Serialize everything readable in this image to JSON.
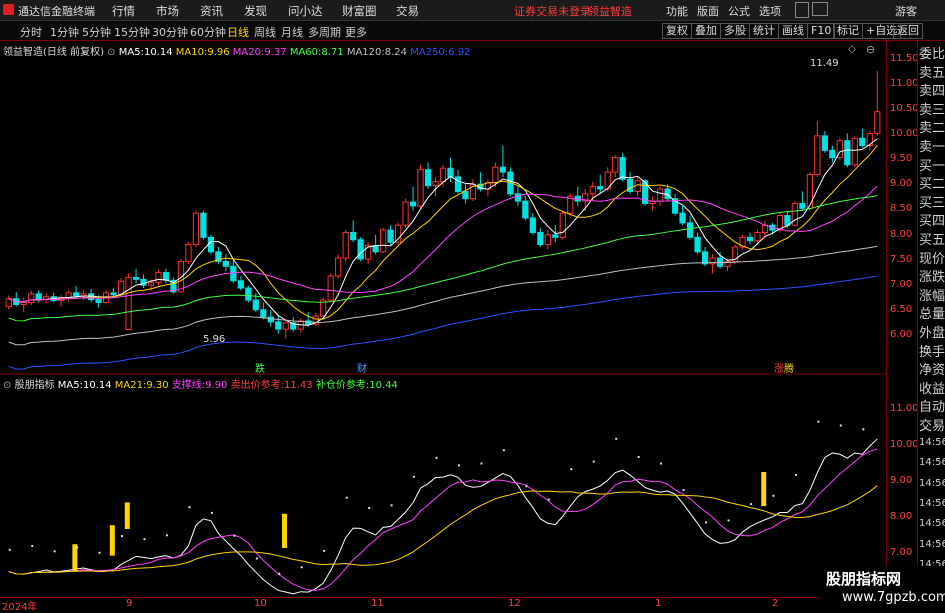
{
  "titlebar": {
    "app_title": "通达信金融终端",
    "menus": [
      "行情",
      "市场",
      "资讯",
      "发现",
      "问小达",
      "财富圈",
      "交易"
    ],
    "alert_login": "证券交易未登录",
    "alert_stock": "领益智造",
    "right_menus": [
      "功能",
      "版面",
      "公式",
      "选项"
    ],
    "user": "游客"
  },
  "toolbar": {
    "periods": [
      "分时",
      "1分钟",
      "5分钟",
      "15分钟",
      "30分钟",
      "60分钟",
      "日线",
      "周线",
      "月线",
      "多周期",
      "更多"
    ],
    "active_period": "日线",
    "buttons": [
      "复权",
      "叠加",
      "多股",
      "统计",
      "画线",
      "F10",
      "标记",
      "+自选",
      "返回"
    ]
  },
  "main_chart": {
    "stock_title": "领益智造(日线 前复权)",
    "ma": [
      {
        "label": "MA5:",
        "value": "10.14",
        "color": "#ffffff"
      },
      {
        "label": "MA10:",
        "value": "9.96",
        "color": "#ffd400"
      },
      {
        "label": "MA20:",
        "value": "9.37",
        "color": "#ff40ff"
      },
      {
        "label": "MA60:",
        "value": "8.71",
        "color": "#40ff40"
      },
      {
        "label": "MA120:",
        "value": "8.24",
        "color": "#c0c0c0"
      },
      {
        "label": "MA250:",
        "value": "6.92",
        "color": "#3050ff"
      }
    ],
    "max_label": "11.49",
    "min_label": "5.96",
    "event_labels": [
      {
        "text": "跌",
        "color": "#40ff40"
      },
      {
        "text": "财",
        "color": "#40a0ff"
      },
      {
        "text": "涨",
        "color": "#ff4040"
      },
      {
        "text": "腾",
        "color": "#ffd400"
      }
    ]
  },
  "sub_chart": {
    "indicator_name": "股朋指标",
    "items": [
      {
        "label": "MA5:",
        "value": "10.14",
        "color": "#ffffff"
      },
      {
        "label": "MA21:",
        "value": "9.30",
        "color": "#ffd400"
      },
      {
        "label": "支撑线:",
        "value": "9.90",
        "color": "#ff40ff"
      },
      {
        "label": "卖出价参考:",
        "value": "11.43",
        "color": "#ff4040"
      },
      {
        "label": "补仓价参考:",
        "value": "10.44",
        "color": "#40ff40"
      }
    ]
  },
  "price_axis": [
    "11.50",
    "11.00",
    "10.50",
    "10.00",
    "9.50",
    "9.00",
    "8.50",
    "8.00",
    "7.50",
    "7.00",
    "6.50",
    "6.00"
  ],
  "sub_axis": [
    "11.00",
    "10.00",
    "9.00",
    "8.00",
    "7.00"
  ],
  "time_axis": [
    "2024年",
    "9",
    "10",
    "11",
    "12",
    "1",
    "2"
  ],
  "right_panel": [
    "委比",
    "卖五",
    "卖四",
    "卖三",
    "卖二",
    "卖一",
    "买一",
    "买二",
    "买三",
    "买四",
    "买五",
    "现价",
    "涨跌",
    "涨幅",
    "总量",
    "外盘",
    "换手",
    "净资",
    "收益",
    "自动",
    "交易",
    "14:56",
    "14:56",
    "14:56",
    "14:56",
    "14:56",
    "14:56",
    "14:56",
    "14:56"
  ],
  "watermark": {
    "line1": "股朋指标网",
    "line2": "www.7gpzb.com"
  },
  "chart_data": {
    "type": "candlestick",
    "ylim": [
      5.8,
      11.7
    ],
    "ohlc": [
      [
        6.62,
        6.85,
        6.55,
        6.78
      ],
      [
        6.78,
        6.92,
        6.62,
        6.66
      ],
      [
        6.66,
        6.8,
        6.5,
        6.7
      ],
      [
        6.7,
        6.95,
        6.65,
        6.88
      ],
      [
        6.88,
        6.95,
        6.7,
        6.76
      ],
      [
        6.76,
        6.9,
        6.68,
        6.82
      ],
      [
        6.82,
        6.9,
        6.7,
        6.74
      ],
      [
        6.74,
        6.85,
        6.62,
        6.8
      ],
      [
        6.8,
        6.95,
        6.72,
        6.9
      ],
      [
        6.9,
        7.05,
        6.8,
        6.84
      ],
      [
        6.84,
        6.95,
        6.75,
        6.88
      ],
      [
        6.88,
        6.98,
        6.7,
        6.76
      ],
      [
        6.76,
        6.85,
        6.6,
        6.7
      ],
      [
        6.7,
        6.95,
        6.68,
        6.9
      ],
      [
        6.9,
        7.0,
        6.8,
        6.86
      ],
      [
        6.86,
        7.2,
        6.84,
        7.14
      ],
      [
        6.14,
        7.3,
        7.0,
        7.22
      ],
      [
        7.22,
        7.4,
        7.1,
        7.18
      ],
      [
        7.18,
        7.28,
        7.0,
        7.06
      ],
      [
        7.06,
        7.18,
        6.95,
        7.12
      ],
      [
        7.12,
        7.38,
        7.05,
        7.32
      ],
      [
        7.32,
        7.4,
        7.1,
        7.16
      ],
      [
        7.16,
        7.22,
        6.88,
        6.92
      ],
      [
        6.92,
        7.6,
        6.9,
        7.55
      ],
      [
        7.55,
        7.95,
        7.5,
        7.9
      ],
      [
        7.9,
        8.6,
        7.85,
        8.55
      ],
      [
        8.55,
        8.6,
        8.0,
        8.05
      ],
      [
        8.05,
        8.1,
        7.7,
        7.75
      ],
      [
        7.75,
        7.85,
        7.5,
        7.55
      ],
      [
        7.55,
        7.7,
        7.35,
        7.45
      ],
      [
        7.45,
        7.6,
        7.1,
        7.15
      ],
      [
        7.15,
        7.25,
        6.95,
        7.0
      ],
      [
        7.0,
        7.05,
        6.7,
        6.75
      ],
      [
        6.75,
        6.9,
        6.5,
        6.55
      ],
      [
        6.55,
        6.7,
        6.35,
        6.4
      ],
      [
        6.4,
        6.55,
        6.2,
        6.3
      ],
      [
        6.3,
        6.45,
        6.05,
        6.15
      ],
      [
        6.15,
        6.35,
        5.96,
        6.28
      ],
      [
        6.28,
        6.4,
        6.1,
        6.15
      ],
      [
        6.15,
        6.38,
        6.08,
        6.32
      ],
      [
        6.32,
        6.5,
        6.2,
        6.25
      ],
      [
        6.25,
        6.48,
        6.22,
        6.42
      ],
      [
        6.42,
        6.8,
        6.4,
        6.75
      ],
      [
        6.75,
        7.3,
        6.7,
        7.25
      ],
      [
        7.25,
        7.7,
        7.2,
        7.62
      ],
      [
        7.62,
        8.2,
        7.55,
        8.15
      ],
      [
        8.15,
        8.4,
        7.95,
        8.0
      ],
      [
        8.0,
        8.05,
        7.55,
        7.6
      ],
      [
        7.6,
        7.95,
        7.5,
        7.88
      ],
      [
        7.88,
        8.1,
        7.7,
        7.75
      ],
      [
        7.75,
        8.25,
        7.72,
        8.2
      ],
      [
        8.2,
        8.3,
        7.9,
        7.95
      ],
      [
        7.95,
        8.35,
        7.9,
        8.3
      ],
      [
        8.3,
        8.85,
        8.25,
        8.78
      ],
      [
        8.78,
        9.1,
        8.6,
        8.7
      ],
      [
        8.7,
        9.55,
        8.65,
        9.45
      ],
      [
        9.45,
        9.6,
        9.05,
        9.12
      ],
      [
        9.12,
        9.3,
        8.9,
        9.2
      ],
      [
        9.2,
        9.55,
        9.1,
        9.48
      ],
      [
        9.48,
        9.7,
        9.2,
        9.3
      ],
      [
        9.3,
        9.45,
        8.95,
        9.0
      ],
      [
        9.0,
        9.15,
        8.75,
        8.85
      ],
      [
        8.85,
        9.25,
        8.8,
        9.15
      ],
      [
        9.15,
        9.4,
        9.0,
        9.05
      ],
      [
        9.05,
        9.25,
        8.9,
        9.18
      ],
      [
        9.18,
        9.6,
        9.1,
        9.5
      ],
      [
        9.5,
        9.95,
        9.3,
        9.4
      ],
      [
        9.4,
        9.5,
        8.9,
        8.95
      ],
      [
        8.95,
        9.1,
        8.7,
        8.8
      ],
      [
        8.8,
        8.9,
        8.4,
        8.45
      ],
      [
        8.45,
        8.55,
        8.1,
        8.15
      ],
      [
        8.15,
        8.25,
        7.85,
        7.9
      ],
      [
        7.9,
        8.2,
        7.8,
        8.1
      ],
      [
        8.1,
        8.3,
        7.95,
        8.05
      ],
      [
        8.05,
        8.6,
        8.0,
        8.55
      ],
      [
        8.55,
        8.95,
        8.5,
        8.9
      ],
      [
        8.9,
        9.1,
        8.7,
        8.8
      ],
      [
        8.8,
        9.05,
        8.6,
        8.95
      ],
      [
        8.95,
        9.2,
        8.8,
        9.1
      ],
      [
        9.1,
        9.35,
        8.95,
        9.05
      ],
      [
        9.05,
        9.5,
        9.0,
        9.4
      ],
      [
        9.4,
        9.75,
        9.3,
        9.7
      ],
      [
        9.7,
        9.8,
        9.2,
        9.25
      ],
      [
        9.25,
        9.4,
        8.95,
        9.0
      ],
      [
        9.0,
        9.3,
        8.9,
        9.22
      ],
      [
        9.22,
        9.25,
        8.7,
        8.75
      ],
      [
        8.75,
        8.9,
        8.6,
        8.8
      ],
      [
        8.8,
        9.1,
        8.7,
        9.05
      ],
      [
        9.05,
        9.15,
        8.8,
        8.85
      ],
      [
        8.85,
        8.95,
        8.5,
        8.55
      ],
      [
        8.55,
        8.7,
        8.3,
        8.35
      ],
      [
        8.35,
        8.5,
        8.0,
        8.05
      ],
      [
        8.05,
        8.15,
        7.7,
        7.75
      ],
      [
        7.75,
        7.85,
        7.45,
        7.5
      ],
      [
        7.5,
        7.7,
        7.3,
        7.62
      ],
      [
        7.62,
        7.75,
        7.4,
        7.45
      ],
      [
        7.45,
        7.6,
        7.35,
        7.55
      ],
      [
        7.55,
        7.9,
        7.5,
        7.85
      ],
      [
        7.85,
        8.1,
        7.8,
        8.05
      ],
      [
        8.05,
        8.15,
        7.9,
        7.98
      ],
      [
        7.98,
        8.2,
        7.9,
        8.15
      ],
      [
        8.15,
        8.4,
        8.05,
        8.3
      ],
      [
        8.3,
        8.35,
        8.1,
        8.2
      ],
      [
        8.2,
        8.55,
        8.15,
        8.5
      ],
      [
        8.5,
        8.6,
        8.25,
        8.3
      ],
      [
        8.3,
        8.8,
        8.28,
        8.75
      ],
      [
        8.75,
        9.0,
        8.6,
        8.65
      ],
      [
        8.65,
        9.4,
        8.6,
        9.35
      ],
      [
        9.35,
        10.45,
        9.3,
        10.15
      ],
      [
        10.15,
        10.25,
        9.8,
        9.85
      ],
      [
        9.85,
        9.95,
        9.6,
        9.7
      ],
      [
        9.7,
        10.1,
        9.65,
        10.05
      ],
      [
        10.05,
        10.2,
        9.5,
        9.55
      ],
      [
        9.55,
        10.15,
        9.5,
        10.1
      ],
      [
        10.1,
        10.3,
        9.9,
        9.95
      ],
      [
        9.95,
        10.25,
        9.85,
        10.2
      ],
      [
        10.2,
        11.49,
        10.15,
        10.65
      ]
    ]
  }
}
